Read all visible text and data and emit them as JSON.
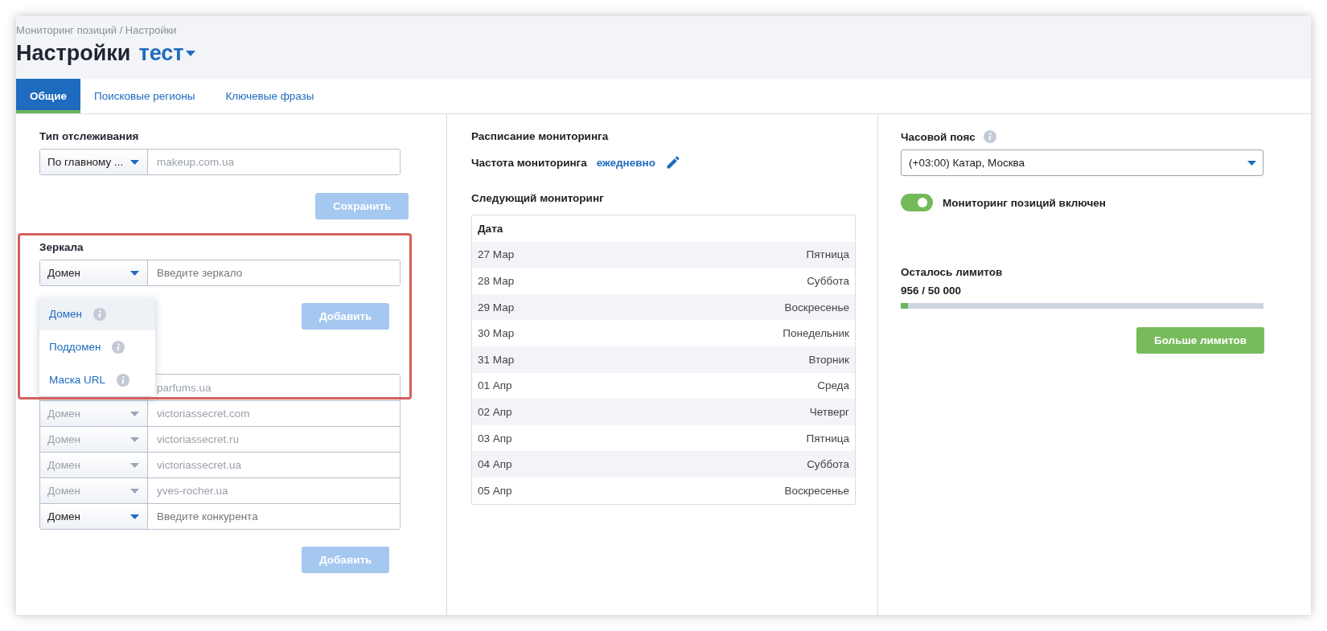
{
  "breadcrumb": "Мониторинг позиций / Настройки",
  "title": "Настройки",
  "project": {
    "label": "тест"
  },
  "tabs": [
    {
      "label": "Общие",
      "selected": true
    },
    {
      "label": "Поисковые регионы",
      "selected": false
    },
    {
      "label": "Ключевые фразы",
      "selected": false
    }
  ],
  "tracking": {
    "label": "Тип отслеживания",
    "type": "По главному ...",
    "value": "makeup.com.ua",
    "disabled": true,
    "save_button": {
      "label": "Сохранить",
      "disabled": true
    }
  },
  "mirrors": {
    "label": "Зеркала",
    "type": "Домен",
    "placeholder": "Введите зеркало",
    "menu_open": true,
    "menu": [
      {
        "label": "Домен",
        "selected": true
      },
      {
        "label": "Поддомен",
        "selected": false
      },
      {
        "label": "Маска URL",
        "selected": false
      }
    ],
    "add_button": {
      "label": "Добавить",
      "disabled": true
    }
  },
  "competitors": {
    "rows": [
      {
        "value": "parfums.ua",
        "disabled": true
      },
      {
        "type": "Домен",
        "value": "victoriassecret.com",
        "disabled": true
      },
      {
        "type": "Домен",
        "value": "victoriassecret.ru",
        "disabled": true
      },
      {
        "type": "Домен",
        "value": "victoriassecret.ua",
        "disabled": true
      },
      {
        "type": "Домен",
        "value": "yves-rocher.ua",
        "disabled": true
      },
      {
        "type": "Домен",
        "placeholder": "Введите конкурента",
        "disabled": false
      }
    ],
    "add_button": {
      "label": "Добавить",
      "disabled": true
    }
  },
  "schedule": {
    "title": "Расписание мониторинга",
    "frequency_label": "Частота мониторинга",
    "frequency_value": "ежедневно",
    "next_title": "Следующий мониторинг",
    "table": {
      "columns": [
        "Дата"
      ],
      "rows": [
        {
          "date": "27 Мар",
          "day": "Пятница"
        },
        {
          "date": "28 Мар",
          "day": "Суббота"
        },
        {
          "date": "29 Мар",
          "day": "Воскресенье"
        },
        {
          "date": "30 Мар",
          "day": "Понедельник"
        },
        {
          "date": "31 Мар",
          "day": "Вторник"
        },
        {
          "date": "01 Апр",
          "day": "Среда"
        },
        {
          "date": "02 Апр",
          "day": "Четверг"
        },
        {
          "date": "03 Апр",
          "day": "Пятница"
        },
        {
          "date": "04 Апр",
          "day": "Суббота"
        },
        {
          "date": "05 Апр",
          "day": "Воскресенье"
        }
      ]
    }
  },
  "timezone": {
    "label": "Часовой пояс",
    "value": "(+03:00) Катар, Москва"
  },
  "monitoring_toggle": {
    "label": "Мониторинг позиций включен",
    "on": true
  },
  "limits": {
    "label": "Осталось лимитов",
    "reading": "956 / 50 000",
    "level": 0.02,
    "button": {
      "label": "Больше лимитов",
      "disabled": false
    }
  }
}
